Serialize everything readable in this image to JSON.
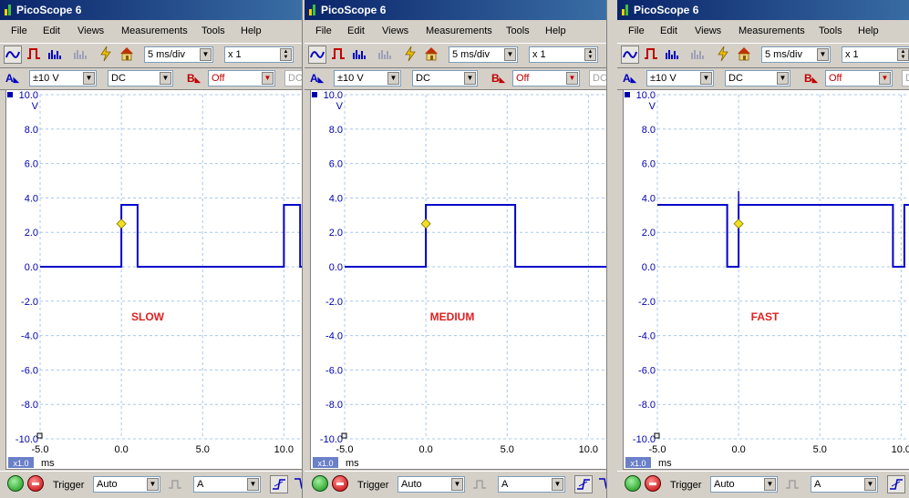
{
  "app": {
    "title": "PicoScope 6"
  },
  "menu": {
    "file": "File",
    "edit": "Edit",
    "views": "Views",
    "measurements": "Measurements",
    "tools": "Tools",
    "help": "Help"
  },
  "toolbar": {
    "timebase": "5 ms/div",
    "zoom": "x 1"
  },
  "channel_a": {
    "letter": "A",
    "range": "±10 V",
    "coupling": "DC"
  },
  "channel_b": {
    "letter": "B",
    "range": "Off",
    "coupling": "DC"
  },
  "trigger": {
    "label": "Trigger",
    "mode": "Auto",
    "source": "A"
  },
  "axis": {
    "unit_y": "V",
    "unit_x": "ms",
    "zoom_badge": "x1.0"
  },
  "colors": {
    "trace": "#0000c8",
    "grid": "#a8c8e8",
    "annotation": "#e02020",
    "marker": "#f0e020"
  },
  "panels": [
    {
      "label": "SLOW"
    },
    {
      "label": "MEDIUM"
    },
    {
      "label": "FAST"
    }
  ],
  "chart_data": [
    {
      "type": "line",
      "x_ticks": [
        "-5.0",
        "0.0",
        "5.0",
        "10.0"
      ],
      "y_ticks": [
        "10.0",
        "8.0",
        "6.0",
        "4.0",
        "2.0",
        "0.0",
        "-2.0",
        "-4.0",
        "-6.0",
        "-8.0",
        "-10.0"
      ],
      "xlim": [
        -5,
        12
      ],
      "ylim": [
        -10,
        10
      ],
      "xlabel": "ms",
      "ylabel": "V",
      "series": [
        {
          "x": [
            -5,
            0,
            0,
            1,
            1,
            10,
            10,
            11,
            11,
            12
          ],
          "y": [
            0,
            0,
            3.6,
            3.6,
            0,
            0,
            3.6,
            3.6,
            0,
            0
          ]
        }
      ],
      "trigger_marker": {
        "x": 0,
        "y": 2.5
      },
      "annotation": "SLOW"
    },
    {
      "type": "line",
      "x_ticks": [
        "-5.0",
        "0.0",
        "5.0",
        "10.0"
      ],
      "y_ticks": [
        "10.0",
        "8.0",
        "6.0",
        "4.0",
        "2.0",
        "0.0",
        "-2.0",
        "-4.0",
        "-6.0",
        "-8.0",
        "-10.0"
      ],
      "xlim": [
        -5,
        12
      ],
      "ylim": [
        -10,
        10
      ],
      "xlabel": "ms",
      "ylabel": "V",
      "series": [
        {
          "x": [
            -5,
            0,
            0,
            5.5,
            5.5,
            11.2,
            11.2,
            12
          ],
          "y": [
            0,
            0,
            3.6,
            3.6,
            0,
            0,
            3.6,
            3.6
          ]
        }
      ],
      "trigger_marker": {
        "x": 0,
        "y": 2.5
      },
      "annotation": "MEDIUM"
    },
    {
      "type": "line",
      "x_ticks": [
        "-5.0",
        "0.0",
        "5.0",
        "10.0"
      ],
      "y_ticks": [
        "10.0",
        "8.0",
        "6.0",
        "4.0",
        "2.0",
        "0.0",
        "-2.0",
        "-4.0",
        "-6.0",
        "-8.0",
        "-10.0"
      ],
      "xlim": [
        -5,
        12
      ],
      "ylim": [
        -10,
        10
      ],
      "xlabel": "ms",
      "ylabel": "V",
      "series": [
        {
          "x": [
            -5,
            -0.7,
            -0.7,
            0,
            0,
            9.5,
            9.5,
            10.2,
            10.2,
            12
          ],
          "y": [
            3.6,
            3.6,
            0,
            0,
            3.6,
            3.6,
            0,
            0,
            3.6,
            3.6
          ]
        }
      ],
      "spike": {
        "x": 0,
        "y": 4.4
      },
      "trigger_marker": {
        "x": 0,
        "y": 2.5
      },
      "annotation": "FAST"
    }
  ]
}
